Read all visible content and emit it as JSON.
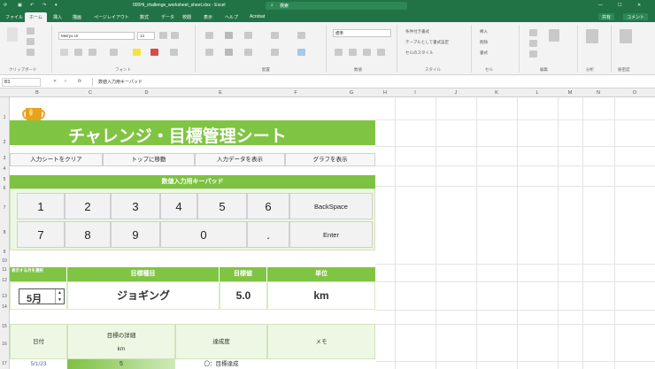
{
  "titlebar": {
    "filename": "000Hi_challenge_worksheet_sheet.xlsx - Excel",
    "search": "検索"
  },
  "tabs": [
    "ファイル",
    "ホーム",
    "挿入",
    "描画",
    "ページレイアウト",
    "数式",
    "データ",
    "校閲",
    "表示",
    "ヘルプ",
    "Acrobat"
  ],
  "tabs_right": {
    "share": "共有",
    "comments": "コメント"
  },
  "ribbon": {
    "font_name": "Meiryo UI",
    "font_size": "14",
    "number_format": "標準",
    "cond_format": "条件付き書式",
    "table_format": "テーブルとして書式設定",
    "cell_styles": "セルのスタイル",
    "insert": "挿入",
    "delete": "削除",
    "format": "書式",
    "groups": [
      "クリップボード",
      "フォント",
      "配置",
      "数値",
      "スタイル",
      "セル",
      "編集",
      "分析",
      "秘密度"
    ]
  },
  "formula_bar": {
    "name_box": "B3",
    "fx": "fx",
    "content": "数値入力用キーパッド"
  },
  "columns": [
    "B",
    "C",
    "D",
    "E",
    "F",
    "G",
    "H",
    "I",
    "J",
    "K",
    "L",
    "M",
    "N",
    "O"
  ],
  "rows": [
    "1",
    "2",
    "3",
    "4",
    "5",
    "6",
    "7",
    "8",
    "9",
    "10",
    "11",
    "12",
    "13",
    "14",
    "15",
    "16",
    "17"
  ],
  "sheet": {
    "title": "チャレンジ・目標管理シート",
    "nav_buttons": [
      "入力シートをクリア",
      "トップに移動",
      "入力データを表示",
      "グラフを表示"
    ],
    "keypad_title": "数値入力用キーパッド",
    "keys_row1": [
      "1",
      "2",
      "3",
      "4",
      "5",
      "6",
      "BackSpace"
    ],
    "keys_row2": [
      "7",
      "8",
      "9",
      "0",
      ".",
      "Enter"
    ],
    "goal_headers": [
      "表示する月を選択",
      "目標種目",
      "目標値",
      "単位"
    ],
    "goal_values": {
      "month": "5月",
      "activity": "ジョギング",
      "target": "5.0",
      "unit": "km"
    },
    "table_headers": {
      "date": "日付",
      "detail": "目標の詳細",
      "detail_unit": "km",
      "rate": "達成度",
      "memo": "メモ"
    },
    "first_row": {
      "date": "5/1/23",
      "value": "5",
      "status": "〇：目標達成"
    }
  }
}
